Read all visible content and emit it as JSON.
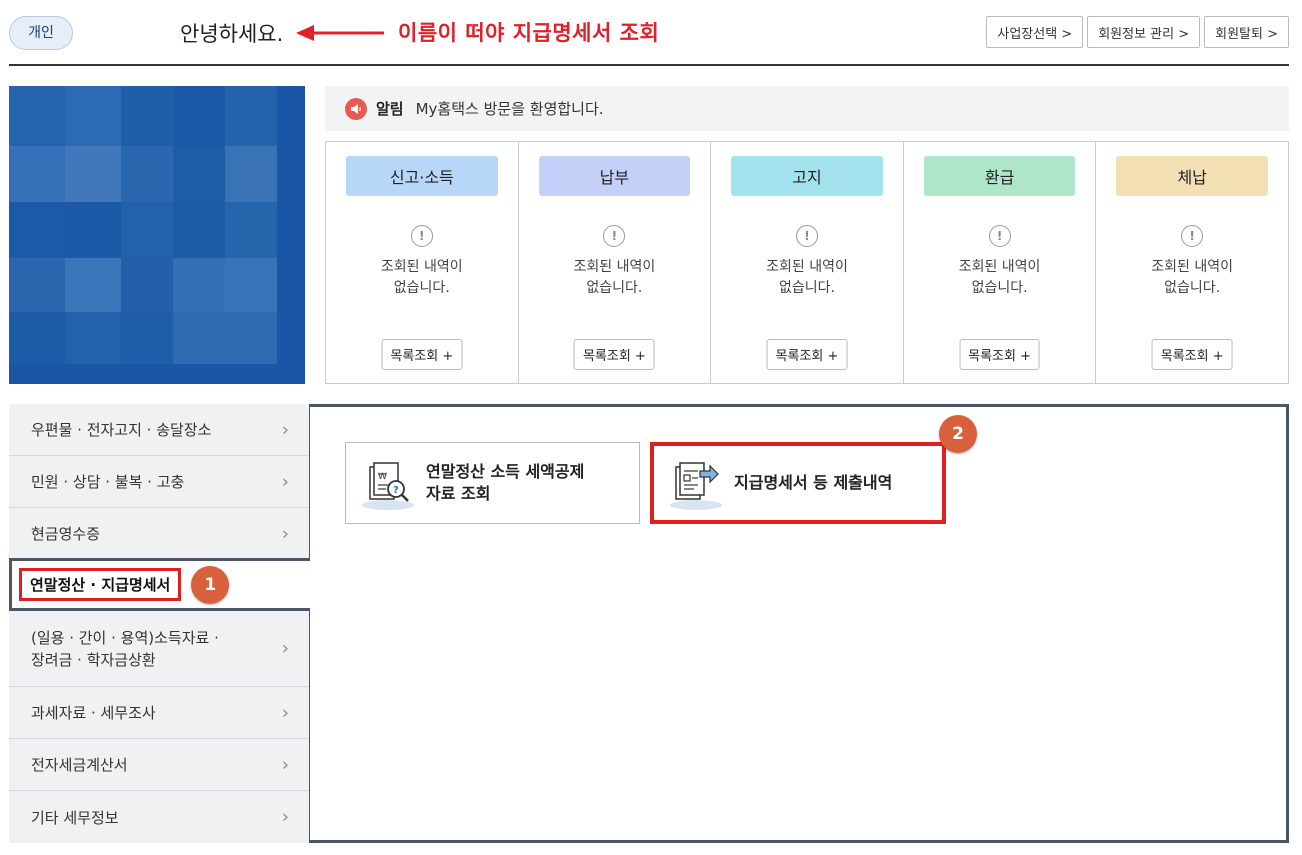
{
  "header": {
    "user_type": "개인",
    "greeting": "안녕하세요.",
    "annotation": "이름이 떠야 지급명세서 조회",
    "buttons": [
      "사업장선택 >",
      "회원정보 관리 >",
      "회원탈퇴 >"
    ]
  },
  "notice": {
    "icon": "megaphone-icon",
    "label": "알림",
    "text": "My홈택스 방문을 환영합니다."
  },
  "status": {
    "columns": [
      {
        "title": "신고·소득",
        "color": "#b8d6f8",
        "message_line1": "조회된 내역이",
        "message_line2": "없습니다.",
        "button": "목록조회 +"
      },
      {
        "title": "납부",
        "color": "#c5d0f8",
        "message_line1": "조회된 내역이",
        "message_line2": "없습니다.",
        "button": "목록조회 +"
      },
      {
        "title": "고지",
        "color": "#a4e2ee",
        "message_line1": "조회된 내역이",
        "message_line2": "없습니다.",
        "button": "목록조회 +"
      },
      {
        "title": "환급",
        "color": "#ade6c8",
        "message_line1": "조회된 내역이",
        "message_line2": "없습니다.",
        "button": "목록조회 +"
      },
      {
        "title": "체납",
        "color": "#f3e0b4",
        "message_line1": "조회된 내역이",
        "message_line2": "없습니다.",
        "button": "목록조회 +"
      }
    ]
  },
  "sidebar": {
    "items": [
      {
        "label": "우편물 · 전자고지 · 송달장소"
      },
      {
        "label": "민원 · 상담 · 불복 · 고충"
      },
      {
        "label": "현금영수증"
      },
      {
        "label": "연말정산 · 지급명세서",
        "active": true,
        "badge": "1"
      },
      {
        "label_line1": "(일용 · 간이 · 용역)소득자료 ·",
        "label_line2": "장려금 · 학자금상환"
      },
      {
        "label": "과세자료 · 세무조사"
      },
      {
        "label": "전자세금계산서"
      },
      {
        "label": "기타 세무정보"
      }
    ]
  },
  "main": {
    "cards": [
      {
        "label_line1": "연말정산 소득 세액공제",
        "label_line2": "자료 조회",
        "icon": "document-search-icon"
      },
      {
        "label": "지급명세서 등 제출내역",
        "icon": "document-submit-icon",
        "badge": "2"
      }
    ]
  },
  "colors": {
    "annotation_red": "#e0202a",
    "badge_orange": "#d9603c",
    "profile_blue": "#1a56a5"
  }
}
